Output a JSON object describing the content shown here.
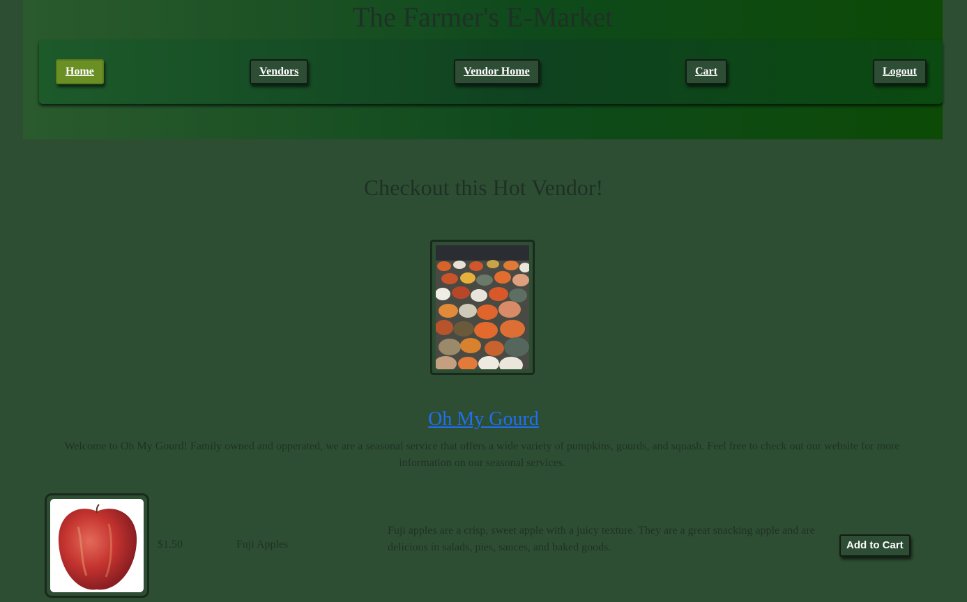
{
  "header": {
    "title": "The Farmer's E-Market"
  },
  "nav": {
    "items": [
      {
        "label": "Home",
        "active": true
      },
      {
        "label": "Vendors",
        "active": false
      },
      {
        "label": "Vendor Home",
        "active": false
      },
      {
        "label": "Cart",
        "active": false
      },
      {
        "label": "Logout",
        "active": false
      }
    ]
  },
  "featured": {
    "heading": "Checkout this Hot Vendor!",
    "vendor_name": "Oh My Gourd",
    "vendor_description": "Welcome to Oh My Gourd! Family owned and opperated, we are a seasonal service that offers a wide variety of pumpkins, gourds, and squash. Feel free to check out our website for more information on our seasonal services."
  },
  "products": [
    {
      "price": "$1.50",
      "name": "Fuji Apples",
      "description": "Fuji apples are a crisp, sweet apple with a juicy texture. They are a great snacking apple and are delicious in salads, pies, sauces, and baked goods.",
      "button_label": "Add to Cart"
    }
  ],
  "colors": {
    "background": "#2e4e33",
    "active_nav": "#6a8f24",
    "link": "#1f6ff0"
  }
}
